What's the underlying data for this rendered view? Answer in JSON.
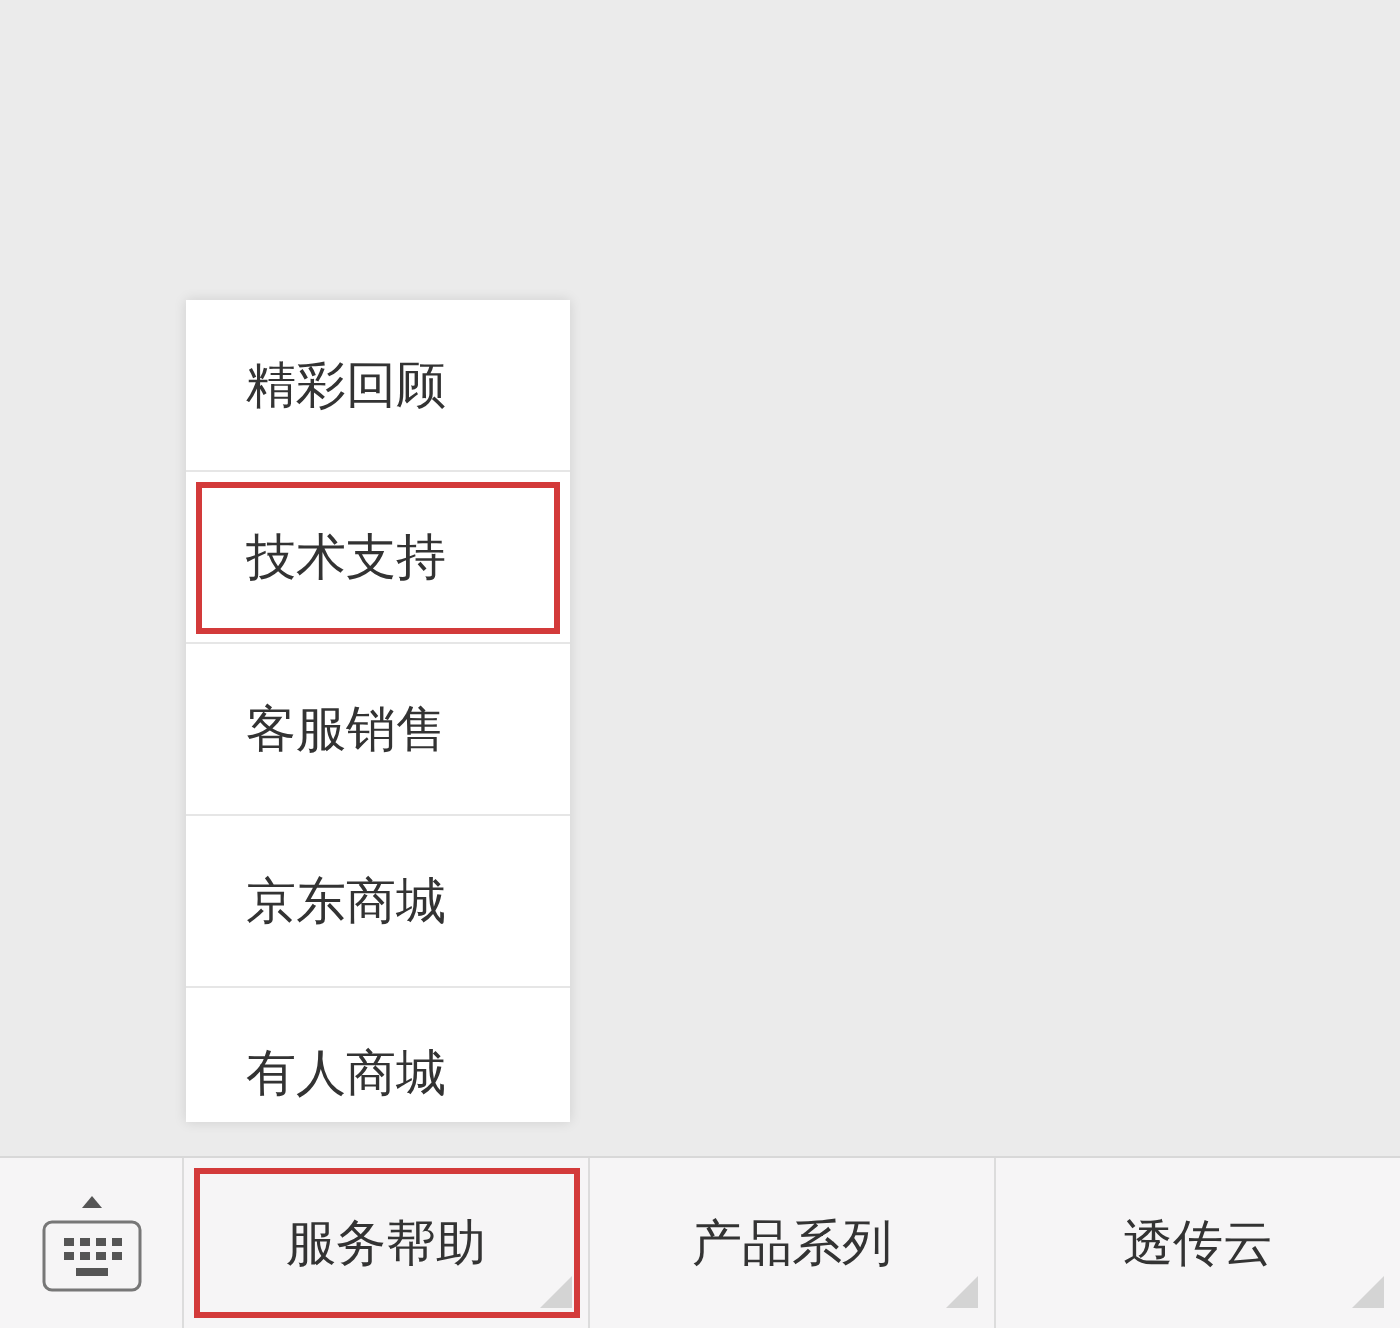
{
  "submenu": {
    "items": [
      {
        "label": "精彩回顾",
        "highlighted": false
      },
      {
        "label": "技术支持",
        "highlighted": true
      },
      {
        "label": "客服销售",
        "highlighted": false
      },
      {
        "label": "京东商城",
        "highlighted": false
      },
      {
        "label": "有人商城",
        "highlighted": false
      }
    ]
  },
  "menu_bar": {
    "items": [
      {
        "label": "服务帮助",
        "highlighted": true
      },
      {
        "label": "产品系列",
        "highlighted": false
      },
      {
        "label": "透传云",
        "highlighted": false
      }
    ]
  }
}
